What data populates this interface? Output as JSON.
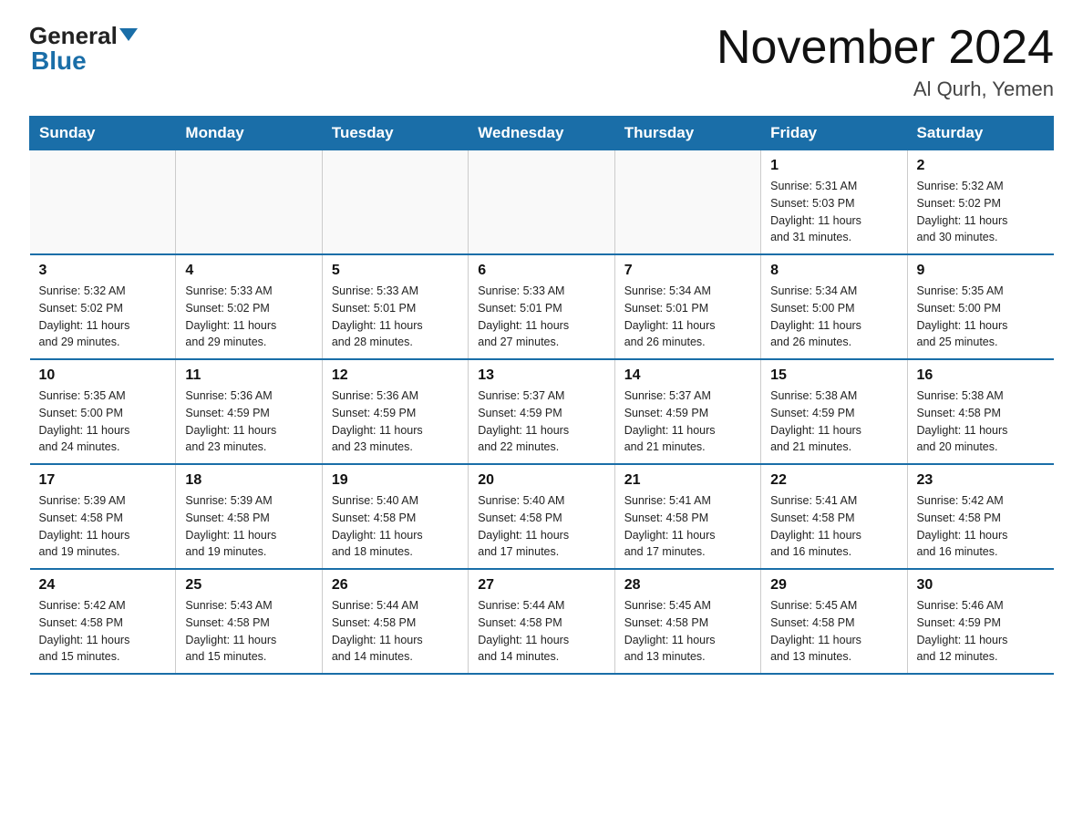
{
  "header": {
    "logo_general": "General",
    "logo_blue": "Blue",
    "title": "November 2024",
    "subtitle": "Al Qurh, Yemen"
  },
  "days_of_week": [
    "Sunday",
    "Monday",
    "Tuesday",
    "Wednesday",
    "Thursday",
    "Friday",
    "Saturday"
  ],
  "weeks": [
    {
      "days": [
        {
          "num": "",
          "info": ""
        },
        {
          "num": "",
          "info": ""
        },
        {
          "num": "",
          "info": ""
        },
        {
          "num": "",
          "info": ""
        },
        {
          "num": "",
          "info": ""
        },
        {
          "num": "1",
          "info": "Sunrise: 5:31 AM\nSunset: 5:03 PM\nDaylight: 11 hours\nand 31 minutes."
        },
        {
          "num": "2",
          "info": "Sunrise: 5:32 AM\nSunset: 5:02 PM\nDaylight: 11 hours\nand 30 minutes."
        }
      ]
    },
    {
      "days": [
        {
          "num": "3",
          "info": "Sunrise: 5:32 AM\nSunset: 5:02 PM\nDaylight: 11 hours\nand 29 minutes."
        },
        {
          "num": "4",
          "info": "Sunrise: 5:33 AM\nSunset: 5:02 PM\nDaylight: 11 hours\nand 29 minutes."
        },
        {
          "num": "5",
          "info": "Sunrise: 5:33 AM\nSunset: 5:01 PM\nDaylight: 11 hours\nand 28 minutes."
        },
        {
          "num": "6",
          "info": "Sunrise: 5:33 AM\nSunset: 5:01 PM\nDaylight: 11 hours\nand 27 minutes."
        },
        {
          "num": "7",
          "info": "Sunrise: 5:34 AM\nSunset: 5:01 PM\nDaylight: 11 hours\nand 26 minutes."
        },
        {
          "num": "8",
          "info": "Sunrise: 5:34 AM\nSunset: 5:00 PM\nDaylight: 11 hours\nand 26 minutes."
        },
        {
          "num": "9",
          "info": "Sunrise: 5:35 AM\nSunset: 5:00 PM\nDaylight: 11 hours\nand 25 minutes."
        }
      ]
    },
    {
      "days": [
        {
          "num": "10",
          "info": "Sunrise: 5:35 AM\nSunset: 5:00 PM\nDaylight: 11 hours\nand 24 minutes."
        },
        {
          "num": "11",
          "info": "Sunrise: 5:36 AM\nSunset: 4:59 PM\nDaylight: 11 hours\nand 23 minutes."
        },
        {
          "num": "12",
          "info": "Sunrise: 5:36 AM\nSunset: 4:59 PM\nDaylight: 11 hours\nand 23 minutes."
        },
        {
          "num": "13",
          "info": "Sunrise: 5:37 AM\nSunset: 4:59 PM\nDaylight: 11 hours\nand 22 minutes."
        },
        {
          "num": "14",
          "info": "Sunrise: 5:37 AM\nSunset: 4:59 PM\nDaylight: 11 hours\nand 21 minutes."
        },
        {
          "num": "15",
          "info": "Sunrise: 5:38 AM\nSunset: 4:59 PM\nDaylight: 11 hours\nand 21 minutes."
        },
        {
          "num": "16",
          "info": "Sunrise: 5:38 AM\nSunset: 4:58 PM\nDaylight: 11 hours\nand 20 minutes."
        }
      ]
    },
    {
      "days": [
        {
          "num": "17",
          "info": "Sunrise: 5:39 AM\nSunset: 4:58 PM\nDaylight: 11 hours\nand 19 minutes."
        },
        {
          "num": "18",
          "info": "Sunrise: 5:39 AM\nSunset: 4:58 PM\nDaylight: 11 hours\nand 19 minutes."
        },
        {
          "num": "19",
          "info": "Sunrise: 5:40 AM\nSunset: 4:58 PM\nDaylight: 11 hours\nand 18 minutes."
        },
        {
          "num": "20",
          "info": "Sunrise: 5:40 AM\nSunset: 4:58 PM\nDaylight: 11 hours\nand 17 minutes."
        },
        {
          "num": "21",
          "info": "Sunrise: 5:41 AM\nSunset: 4:58 PM\nDaylight: 11 hours\nand 17 minutes."
        },
        {
          "num": "22",
          "info": "Sunrise: 5:41 AM\nSunset: 4:58 PM\nDaylight: 11 hours\nand 16 minutes."
        },
        {
          "num": "23",
          "info": "Sunrise: 5:42 AM\nSunset: 4:58 PM\nDaylight: 11 hours\nand 16 minutes."
        }
      ]
    },
    {
      "days": [
        {
          "num": "24",
          "info": "Sunrise: 5:42 AM\nSunset: 4:58 PM\nDaylight: 11 hours\nand 15 minutes."
        },
        {
          "num": "25",
          "info": "Sunrise: 5:43 AM\nSunset: 4:58 PM\nDaylight: 11 hours\nand 15 minutes."
        },
        {
          "num": "26",
          "info": "Sunrise: 5:44 AM\nSunset: 4:58 PM\nDaylight: 11 hours\nand 14 minutes."
        },
        {
          "num": "27",
          "info": "Sunrise: 5:44 AM\nSunset: 4:58 PM\nDaylight: 11 hours\nand 14 minutes."
        },
        {
          "num": "28",
          "info": "Sunrise: 5:45 AM\nSunset: 4:58 PM\nDaylight: 11 hours\nand 13 minutes."
        },
        {
          "num": "29",
          "info": "Sunrise: 5:45 AM\nSunset: 4:58 PM\nDaylight: 11 hours\nand 13 minutes."
        },
        {
          "num": "30",
          "info": "Sunrise: 5:46 AM\nSunset: 4:59 PM\nDaylight: 11 hours\nand 12 minutes."
        }
      ]
    }
  ]
}
